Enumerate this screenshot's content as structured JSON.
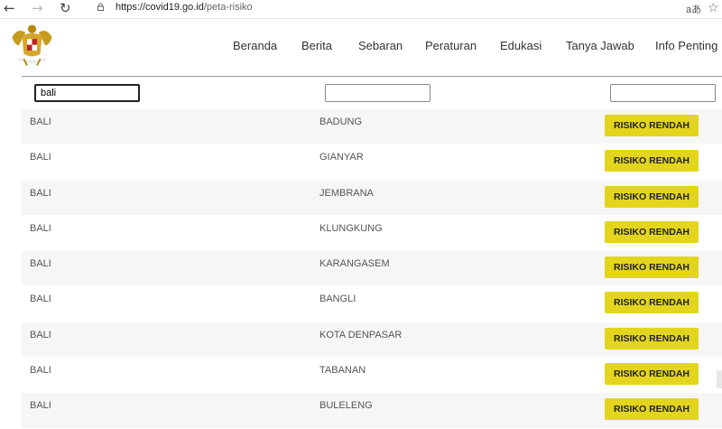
{
  "browser": {
    "url_host": "https://covid19.go.id",
    "url_path": "/peta-risiko",
    "translate_icon": "translate-icon",
    "star_icon": "star-icon"
  },
  "header": {
    "nav": [
      "Beranda",
      "Berita",
      "Sebaran",
      "Peraturan",
      "Edukasi",
      "Tanya Jawab",
      "Info Penting"
    ]
  },
  "filters": {
    "provinsi_value": "bali",
    "kabupaten_value": "",
    "status_value": ""
  },
  "rows": [
    {
      "provinsi": "BALI",
      "kabupaten": "BADUNG",
      "status": "RISIKO RENDAH"
    },
    {
      "provinsi": "BALI",
      "kabupaten": "GIANYAR",
      "status": "RISIKO RENDAH"
    },
    {
      "provinsi": "BALI",
      "kabupaten": "JEMBRANA",
      "status": "RISIKO RENDAH"
    },
    {
      "provinsi": "BALI",
      "kabupaten": "KLUNGKUNG",
      "status": "RISIKO RENDAH"
    },
    {
      "provinsi": "BALI",
      "kabupaten": "KARANGASEM",
      "status": "RISIKO RENDAH"
    },
    {
      "provinsi": "BALI",
      "kabupaten": "BANGLI",
      "status": "RISIKO RENDAH"
    },
    {
      "provinsi": "BALI",
      "kabupaten": "KOTA DENPASAR",
      "status": "RISIKO RENDAH"
    },
    {
      "provinsi": "BALI",
      "kabupaten": "TABANAN",
      "status": "RISIKO RENDAH"
    },
    {
      "provinsi": "BALI",
      "kabupaten": "BULELENG",
      "status": "RISIKO RENDAH"
    }
  ],
  "colors": {
    "badge_low_risk": "#e3d51d"
  }
}
